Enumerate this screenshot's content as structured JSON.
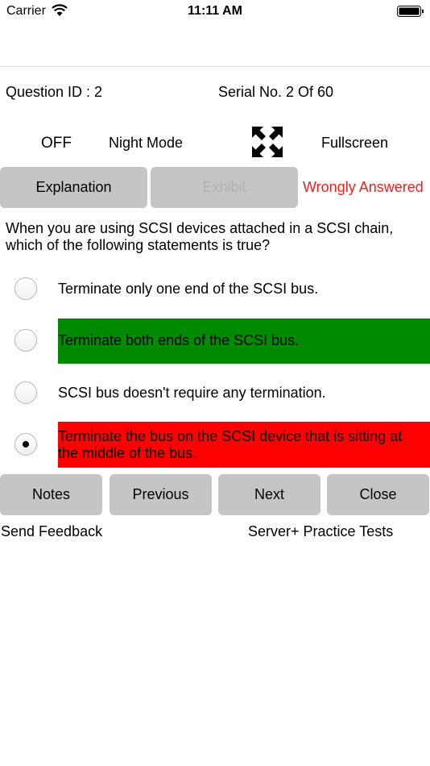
{
  "status_bar": {
    "carrier": "Carrier",
    "time": "11:11 AM"
  },
  "header": {
    "question_id": "Question ID : 2",
    "serial": "Serial No. 2 Of 60"
  },
  "controls": {
    "night_mode_state": "OFF",
    "night_mode_label": "Night Mode",
    "fullscreen_label": "Fullscreen"
  },
  "actions": {
    "explanation": "Explanation",
    "exhibit": "Exhibit",
    "answer_status": "Wrongly Answered",
    "answer_status_color": "#ff1a1a"
  },
  "question": {
    "text": "When you are using SCSI devices attached in a SCSI chain, which of the following statements is true?",
    "options": [
      {
        "text": "Terminate only one end of the SCSI bus.",
        "selected": false,
        "highlight": "none"
      },
      {
        "text": "Terminate both ends of the SCSI bus.",
        "selected": false,
        "highlight": "correct"
      },
      {
        "text": "SCSI bus doesn't require any termination.",
        "selected": false,
        "highlight": "none"
      },
      {
        "text": "Terminate the bus on the SCSI device that is sitting at the middle of the bus.",
        "selected": true,
        "highlight": "wrong"
      }
    ],
    "correct_color": "#008a00",
    "wrong_color": "#ff0000"
  },
  "navigation": {
    "notes": "Notes",
    "previous": "Previous",
    "next": "Next",
    "close": "Close"
  },
  "footer": {
    "send_feedback": "Send Feedback",
    "practice_tests": "Server+ Practice Tests"
  }
}
